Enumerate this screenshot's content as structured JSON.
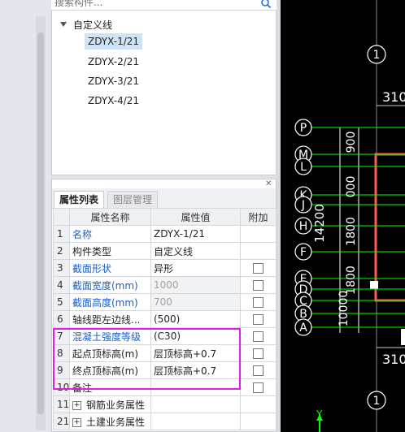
{
  "search": {
    "placeholder": "搜索构件..."
  },
  "tree": {
    "root_label": "自定义线",
    "items": [
      "ZDYX-1/21",
      "ZDYX-2/21",
      "ZDYX-3/21",
      "ZDYX-4/21"
    ],
    "selected_index": 0
  },
  "tabs": {
    "properties": "属性列表",
    "layers": "图层管理"
  },
  "table": {
    "headers": [
      "",
      "属性名称",
      "属性值",
      "附加"
    ],
    "rows": [
      {
        "num": "1",
        "name": "名称",
        "value": "ZDYX-1/21",
        "blue": true,
        "checkbox": false,
        "gray": false
      },
      {
        "num": "2",
        "name": "构件类型",
        "value": "自定义线",
        "blue": false,
        "checkbox": false,
        "gray": false
      },
      {
        "num": "3",
        "name": "截面形状",
        "value": "异形",
        "blue": true,
        "checkbox": true,
        "gray": false
      },
      {
        "num": "4",
        "name": "截面宽度(mm)",
        "value": "1000",
        "blue": true,
        "checkbox": true,
        "gray": true
      },
      {
        "num": "5",
        "name": "截面高度(mm)",
        "value": "700",
        "blue": true,
        "checkbox": true,
        "gray": true
      },
      {
        "num": "6",
        "name": "轴线距左边线...",
        "value": "(500)",
        "blue": false,
        "checkbox": true,
        "gray": false
      },
      {
        "num": "7",
        "name": "混凝土强度等级",
        "value": "(C30)",
        "blue": true,
        "checkbox": true,
        "gray": false
      },
      {
        "num": "8",
        "name": "起点顶标高(m)",
        "value": "层顶标高+0.7",
        "blue": false,
        "checkbox": true,
        "gray": false
      },
      {
        "num": "9",
        "name": "终点顶标高(m)",
        "value": "层顶标高+0.7",
        "blue": false,
        "checkbox": true,
        "gray": false
      },
      {
        "num": "10",
        "name": "备注",
        "value": "",
        "blue": false,
        "checkbox": true,
        "gray": false
      },
      {
        "num": "11",
        "name": "钢筋业务属性",
        "value": "",
        "blue": false,
        "checkbox": false,
        "gray": false,
        "group": true
      },
      {
        "num": "21",
        "name": "土建业务属性",
        "value": "",
        "blue": false,
        "checkbox": false,
        "gray": false,
        "group": true
      }
    ]
  },
  "cad": {
    "axis_labels_top": [
      "1",
      "310"
    ],
    "axis_labels_left": [
      "P",
      "M",
      "L",
      "K",
      "J",
      "H",
      "F",
      "E",
      "D",
      "C",
      "B",
      "A"
    ],
    "dimension_total": "14200",
    "dim_top_fragment": "900",
    "dim_mid_fragment_1": "000",
    "dim_mid_fragment_2": "1800",
    "dim_lower_fragment": "1800",
    "dim_bottom_fragment": "10000",
    "axis_labels_bottom": [
      "310",
      "1"
    ],
    "y_axis_label": "Y",
    "colors": {
      "background": "#000000",
      "axis": "#00ff00",
      "line": "#ffffff",
      "dim": "#ffffff",
      "wall": "#ff3030"
    }
  }
}
